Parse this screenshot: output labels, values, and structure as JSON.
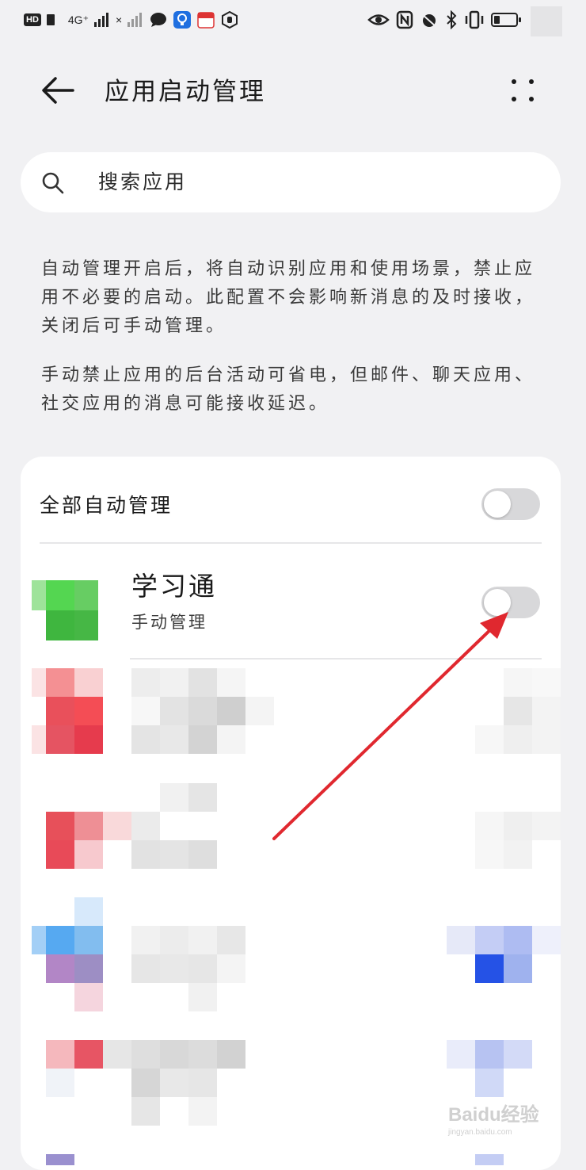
{
  "status_bar": {
    "hd_badge": "HD",
    "signal_1": "4G⁺",
    "signal_2": "×"
  },
  "header": {
    "title": "应用启动管理",
    "back_icon": "arrow-left-icon",
    "more_icon": "more-dots-icon"
  },
  "search": {
    "placeholder": "搜索应用",
    "icon": "search-icon"
  },
  "description": {
    "paragraph_1": "自动管理开启后，将自动识别应用和使用场景，禁止应用不必要的启动。此配置不会影响新消息的及时接收，关闭后可手动管理。",
    "paragraph_2": "手动禁止应用的后台活动可省电，但邮件、聊天应用、社交应用的消息可能接收延迟。"
  },
  "card": {
    "all_auto_label": "全部自动管理",
    "all_auto_enabled": false,
    "apps": [
      {
        "name": "学习通",
        "status": "手动管理",
        "enabled": false
      }
    ]
  },
  "watermark": {
    "text": "Baidu经验",
    "sub": "jingyan.baidu.com"
  },
  "colors": {
    "background": "#f1f1f3",
    "card": "#ffffff",
    "toggle_off": "#d8d8da",
    "annotation_arrow": "#e0282f"
  }
}
